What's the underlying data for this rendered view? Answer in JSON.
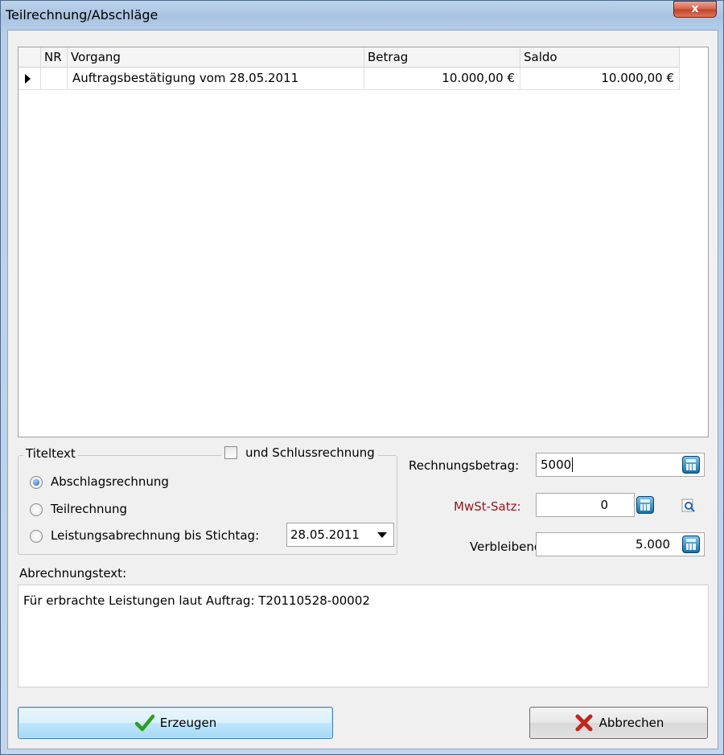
{
  "window": {
    "title": "Teilrechnung/Abschläge",
    "close_label": "x"
  },
  "grid": {
    "columns": [
      "NR",
      "Vorgang",
      "Betrag",
      "Saldo"
    ],
    "rows": [
      {
        "nr": "",
        "vorgang": "Auftragsbestätigung vom 28.05.2011",
        "betrag": "10.000,00 €",
        "saldo": "10.000,00 €"
      }
    ]
  },
  "titeltext": {
    "legend": "Titeltext",
    "schluss_label": "und Schlussrechnung",
    "schluss_checked": false,
    "options": [
      {
        "label": "Abschlagsrechnung",
        "selected": true
      },
      {
        "label": "Teilrechnung",
        "selected": false
      },
      {
        "label": "Leistungsabrechnung bis Stichtag:",
        "selected": false
      }
    ],
    "stichtag": "28.05.2011"
  },
  "fields": {
    "rechnungsbetrag_label": "Rechnungsbetrag:",
    "rechnungsbetrag_value": "5000",
    "mwst_label": "MwSt-Satz:",
    "mwst_value": "0",
    "verbleibend_label": "Verbleibend:",
    "verbleibend_value": "5.000"
  },
  "abrechnung": {
    "label": "Abrechnungstext:",
    "text": "Für erbrachte Leistungen laut Auftrag: T20110528-00002"
  },
  "buttons": {
    "erzeugen": "Erzeugen",
    "abbrechen": "Abbrechen"
  },
  "colors": {
    "mwst_label": "#8b1a1a",
    "check_icon": "#2f9e1f",
    "cancel_icon": "#c0271b"
  }
}
